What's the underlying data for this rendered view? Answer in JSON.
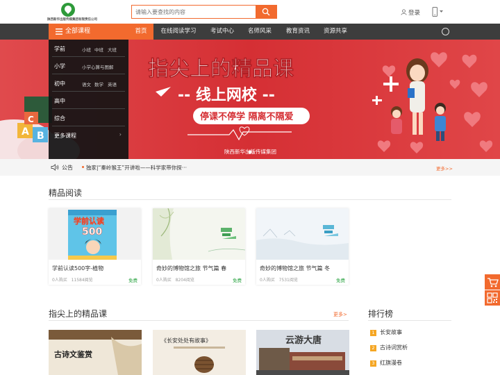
{
  "header": {
    "logo_text": "陕西新华出版传媒集团有限责任公司",
    "search_placeholder": "请输入要查找的内容",
    "login_label": "登录"
  },
  "nav": {
    "all_courses": "全部课程",
    "items": [
      {
        "label": "首页",
        "active": true
      },
      {
        "label": "在线阅读学习",
        "active": false
      },
      {
        "label": "考试中心",
        "active": false
      },
      {
        "label": "名师风采",
        "active": false
      },
      {
        "label": "教育资讯",
        "active": false
      },
      {
        "label": "资源共享",
        "active": false
      }
    ]
  },
  "side_menu": [
    {
      "cat": "学前",
      "subs": [
        "小班",
        "中班",
        "大班"
      ]
    },
    {
      "cat": "小学",
      "subs": [
        "小学心算与图解"
      ]
    },
    {
      "cat": "初中",
      "subs": [
        "语文",
        "数学",
        "英语"
      ]
    },
    {
      "cat": "高中",
      "subs": []
    },
    {
      "cat": "综合",
      "subs": []
    },
    {
      "cat": "更多课程",
      "subs": [],
      "arrow": "›"
    }
  ],
  "banner": {
    "title": "指尖上的精品课",
    "subtitle": "-- 线上网校 --",
    "slogan": "停课不停学  隔离不隔爱",
    "publisher": "陕西新华出版传媒集团",
    "block_letters": [
      "A",
      "B",
      "C"
    ]
  },
  "notice": {
    "label": "公告",
    "text": "独家|“秦岭猴王”开讲啦——科学家带你探···",
    "more": "更多>>"
  },
  "reading": {
    "title": "精品阅读",
    "cards": [
      {
        "title": "学前认读500字-植物",
        "buyers": "0人购买",
        "views": "11584阅览",
        "price": "免费",
        "cover_text": "学前认读",
        "cover_num": "500"
      },
      {
        "title": "奇妙的博物馆之旅 节气篇 春",
        "buyers": "0人购买",
        "views": "8204阅览",
        "price": "免费"
      },
      {
        "title": "奇妙的博物馆之旅 节气篇 冬",
        "buyers": "0人购买",
        "views": "7531阅览",
        "price": "免费"
      }
    ]
  },
  "courses": {
    "title": "指尖上的精品课",
    "more": "更多>",
    "thumb_texts": [
      "古诗文鉴赏",
      "《长安处处有故事》",
      "云游大唐"
    ]
  },
  "ranking": {
    "title": "排行榜",
    "items": [
      "长安故事",
      "古诗词赏析",
      "红旗漫卷"
    ]
  },
  "colors": {
    "accent": "#f26a2e",
    "nav_bg": "#3d3d3d",
    "banner_red": "#d9353a",
    "free_green": "#2aa341"
  }
}
